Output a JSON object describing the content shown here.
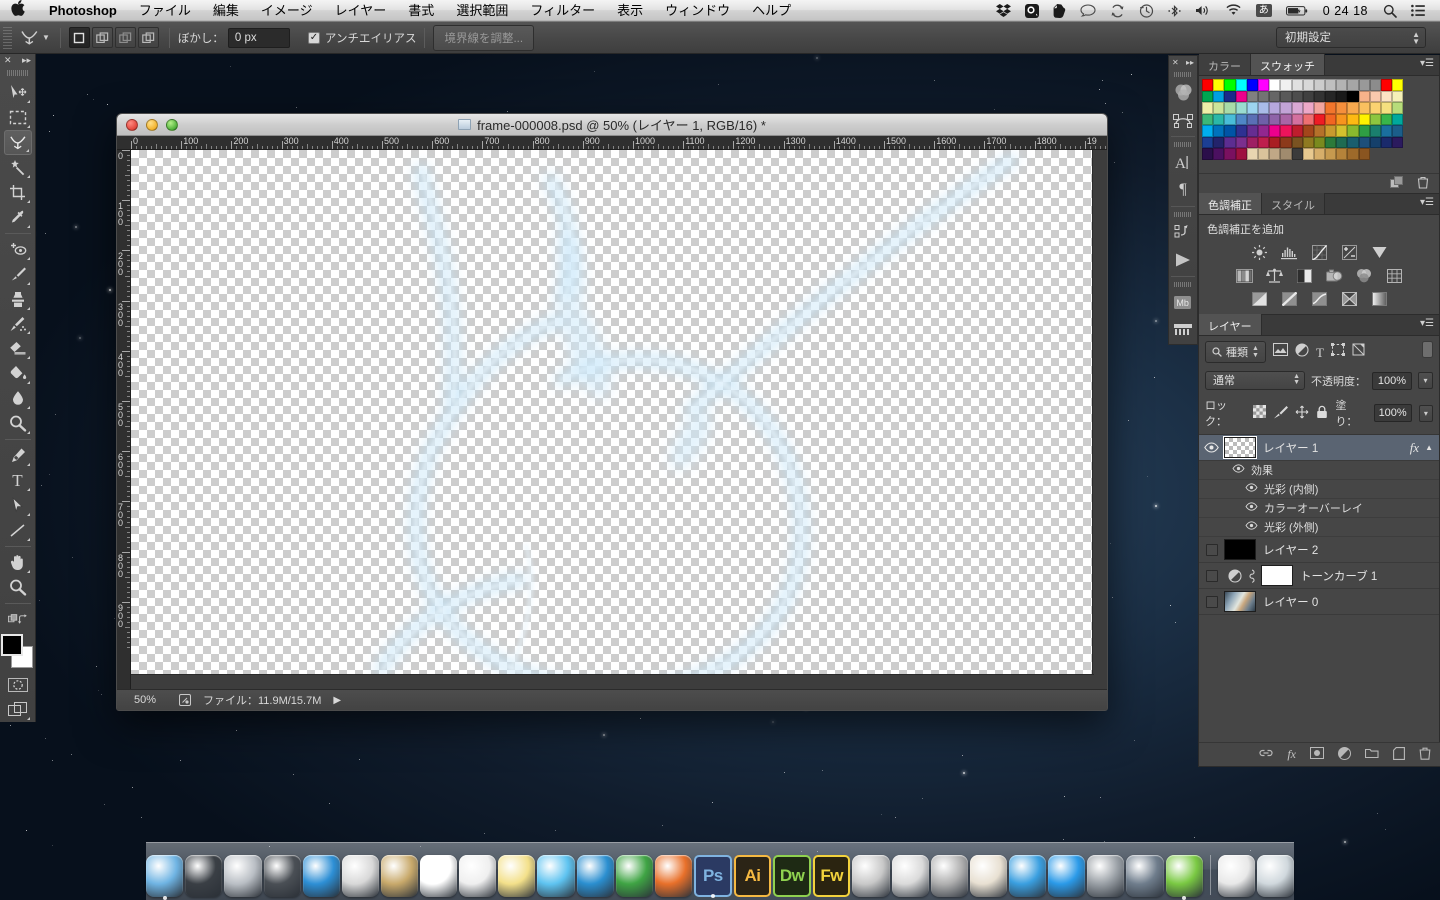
{
  "menubar": {
    "apple_icon": "apple-icon",
    "app_name": "Photoshop",
    "menus": [
      "ファイル",
      "編集",
      "イメージ",
      "レイヤー",
      "書式",
      "選択範囲",
      "フィルター",
      "表示",
      "ウィンドウ",
      "ヘルプ"
    ],
    "status_icons": [
      "dropbox-icon",
      "quicktime-icon",
      "evernote-icon",
      "chat-bubble-icon",
      "sync-icon",
      "time-machine-icon",
      "bluetooth-icon",
      "volume-icon",
      "wifi-icon"
    ],
    "ime_label": "あ",
    "battery_icon": "battery-icon",
    "clock": "0 24 18",
    "spotlight_icon": "search-icon",
    "notification_icon": "list-icon"
  },
  "options_bar": {
    "tool_icon": "lasso-tool-icon",
    "tool_dropdown": "chevron-down-icon",
    "selection_modes": [
      "new-selection",
      "add-to-selection",
      "subtract-from-selection",
      "intersect-selection"
    ],
    "feather_label": "ぼかし：",
    "feather_value": "0 px",
    "antialias_label": "アンチエイリアス",
    "antialias_checked": true,
    "refine_edge_label": "境界線を調整...",
    "workspace_value": "初期設定"
  },
  "toolbar": {
    "collapse_icon": "collapse-icon",
    "expand_icon": "expand-icon",
    "tools": [
      {
        "name": "move-tool",
        "glyph": "move"
      },
      {
        "name": "marquee-tool",
        "glyph": "marquee"
      },
      {
        "name": "lasso-tool",
        "glyph": "lasso",
        "selected": true
      },
      {
        "name": "magic-wand-tool",
        "glyph": "wand"
      },
      {
        "name": "crop-tool",
        "glyph": "crop"
      },
      {
        "name": "eyedropper-tool",
        "glyph": "eyedropper"
      },
      {
        "name": "healing-brush-tool",
        "glyph": "heal"
      },
      {
        "name": "brush-tool",
        "glyph": "brush"
      },
      {
        "name": "clone-stamp-tool",
        "glyph": "stamp"
      },
      {
        "name": "history-brush-tool",
        "glyph": "history-brush"
      },
      {
        "name": "eraser-tool",
        "glyph": "eraser"
      },
      {
        "name": "gradient-tool",
        "glyph": "bucket"
      },
      {
        "name": "blur-tool",
        "glyph": "drop"
      },
      {
        "name": "dodge-tool",
        "glyph": "dodge"
      },
      {
        "name": "pen-tool",
        "glyph": "pen"
      },
      {
        "name": "type-tool",
        "glyph": "T"
      },
      {
        "name": "path-selection-tool",
        "glyph": "arrow"
      },
      {
        "name": "line-tool",
        "glyph": "line"
      },
      {
        "name": "hand-tool",
        "glyph": "hand"
      },
      {
        "name": "zoom-tool",
        "glyph": "zoom"
      }
    ],
    "foreground_color": "#000000",
    "background_color": "#ffffff",
    "quickmask_icon": "quick-mask-icon",
    "screenmode_icon": "screen-mode-icon"
  },
  "document": {
    "title": "frame-000008.psd @ 50% (レイヤー 1, RGB/16) *",
    "traffic_lights": [
      "close-button",
      "minimize-button",
      "zoom-button"
    ],
    "ruler_h_labels": [
      "0",
      "100",
      "200",
      "300",
      "400",
      "500",
      "600",
      "700",
      "800",
      "900",
      "1000",
      "1100",
      "1200",
      "1300",
      "1400",
      "1500",
      "1600",
      "1700",
      "1800",
      "19"
    ],
    "ruler_v_labels": [
      "0",
      "100",
      "200",
      "300",
      "400",
      "500",
      "600",
      "700",
      "800",
      "900"
    ],
    "status_zoom": "50%",
    "status_text": "ファイル：11.9M/15.7M",
    "status_arrow": "play-arrow-icon"
  },
  "icon_dock": {
    "items": [
      {
        "name": "color-panel-icon",
        "glyph": "color"
      },
      {
        "name": "paths-panel-icon",
        "glyph": "paths"
      },
      {
        "name": "character-panel-icon",
        "glyph": "A"
      },
      {
        "name": "paragraph-panel-icon",
        "glyph": "¶"
      },
      {
        "name": "actions-panel-icon",
        "glyph": "actions"
      },
      {
        "name": "timeline-play-icon",
        "glyph": "play"
      },
      {
        "name": "measurement-log-icon",
        "glyph": "Mb"
      },
      {
        "name": "timeline-panel-icon",
        "glyph": "film"
      }
    ]
  },
  "color_panel": {
    "tabs": [
      {
        "label": "カラー",
        "active": false
      },
      {
        "label": "スウォッチ",
        "active": true
      }
    ],
    "menu_icon": "panel-menu-icon",
    "new_swatch_icon": "new-swatch-icon",
    "delete_icon": "trash-icon",
    "swatch_colors": [
      "#ff0000",
      "#ffff00",
      "#00ff00",
      "#00ffff",
      "#0000ff",
      "#ff00ff",
      "#ffffff",
      "#f0f0f0",
      "#e0e0e0",
      "#d8d8d8",
      "#cccccc",
      "#bfbfbf",
      "#b3b3b3",
      "#a6a6a6",
      "#999999",
      "#8c8c8c",
      "#ff0000",
      "#ffff00",
      "#00a651",
      "#00a0e0",
      "#1b2a8a",
      "#ec008c",
      "#808080",
      "#737373",
      "#666666",
      "#595959",
      "#4d4d4d",
      "#404040",
      "#333333",
      "#262626",
      "#1a1a1a",
      "#000000",
      "#f7b38a",
      "#f9c9ad",
      "#fde4c4",
      "#f5f0b8",
      "#eeefa8",
      "#cbe49a",
      "#a8dba8",
      "#9adcd0",
      "#9cd4ef",
      "#a9bce8",
      "#b6a8dd",
      "#c2a3d6",
      "#d9a8d4",
      "#eda8c8",
      "#f2a59e",
      "#f2762c",
      "#f58f3c",
      "#f8a94e",
      "#fac05f",
      "#fbd271",
      "#f5e07f",
      "#b7dc7a",
      "#3cb878",
      "#2bb8a8",
      "#49bdd8",
      "#4f86c6",
      "#5a6fb5",
      "#6f5fa8",
      "#8e63a8",
      "#a965a5",
      "#d4709f",
      "#ef6f72",
      "#ee1c24",
      "#f26522",
      "#f7941e",
      "#fdb913",
      "#fff200",
      "#8dc63f",
      "#39b54a",
      "#00a99d",
      "#00aeef",
      "#0072bc",
      "#0054a6",
      "#2e3192",
      "#662d91",
      "#92278f",
      "#ec008c",
      "#ed145b",
      "#be1e2d",
      "#a3461b",
      "#b5712a",
      "#c99a2e",
      "#d4c12e",
      "#8ab92e",
      "#2f9e44",
      "#1a7f6e",
      "#1a6f9e",
      "#1b5e8a",
      "#1c3f94",
      "#23236b",
      "#5c2d91",
      "#7b2f8e",
      "#9e1f63",
      "#be1e4d",
      "#a91e22",
      "#8c3a1b",
      "#7a5321",
      "#8f7a21",
      "#7a8a1e",
      "#2b7a3a",
      "#1f6b52",
      "#1a5e6e",
      "#1d4f7a",
      "#15406b",
      "#1a2a6b",
      "#2b1a5e",
      "#2b0f4a",
      "#4b1060",
      "#7a1060",
      "#9e1040",
      "#e8d5b0",
      "#d9c39b",
      "#c0a886",
      "#a08b6e",
      "#3b3b3b",
      "#e8c98f",
      "#d6ae6a",
      "#c69a4f",
      "#b5833a",
      "#9e6a2a",
      "#8a5520",
      "",
      "",
      "",
      ""
    ]
  },
  "adjustments_panel": {
    "tabs": [
      {
        "label": "色調補正",
        "active": true
      },
      {
        "label": "スタイル",
        "active": false
      }
    ],
    "menu_icon": "panel-menu-icon",
    "heading": "色調補正を追加",
    "rows": [
      [
        "brightness-contrast-icon",
        "levels-icon",
        "curves-icon",
        "exposure-icon",
        "vibrance-icon"
      ],
      [
        "hue-saturation-icon",
        "color-balance-icon",
        "black-white-icon",
        "photo-filter-icon",
        "channel-mixer-icon",
        "color-lookup-icon"
      ],
      [
        "invert-icon",
        "posterize-icon",
        "threshold-icon",
        "selective-color-icon",
        "gradient-map-icon"
      ]
    ]
  },
  "layers_panel": {
    "tab_label": "レイヤー",
    "menu_icon": "panel-menu-icon",
    "filter_label": "種類",
    "filter_icon": "search-icon",
    "filter_toggles": [
      "pixel-filter-icon",
      "adjustment-filter-icon",
      "type-filter-icon",
      "shape-filter-icon",
      "smartobject-filter-icon"
    ],
    "filter_power_icon": "filter-power-icon",
    "blend_mode": "通常",
    "opacity_label": "不透明度：",
    "opacity_value": "100%",
    "lock_label": "ロック：",
    "lock_icons": [
      "lock-transparency-icon",
      "lock-image-icon",
      "lock-position-icon",
      "lock-all-icon"
    ],
    "fill_label": "塗り：",
    "fill_value": "100%",
    "layers": [
      {
        "name": "レイヤー 1",
        "visible": true,
        "selected": true,
        "thumb": "transparent",
        "fx_badge": "fx",
        "expand_icon": "chevron-up-icon",
        "effects_label": "効果",
        "effects": [
          "光彩 (内側)",
          "カラーオーバーレイ",
          "光彩 (外側)"
        ]
      },
      {
        "name": "レイヤー 2",
        "visible": false,
        "selected": false,
        "thumb": "#000000"
      },
      {
        "name": "トーンカーブ 1",
        "visible": false,
        "selected": false,
        "thumb": "#ffffff",
        "adjustment_icon": "curves-icon",
        "link_icon": "link-icon"
      },
      {
        "name": "レイヤー 0",
        "visible": false,
        "selected": false,
        "thumb": "image"
      }
    ],
    "footer_icons": [
      "link-layers-icon",
      "layer-style-icon",
      "layer-mask-icon",
      "new-adjustment-icon",
      "new-group-icon",
      "new-layer-icon",
      "delete-layer-icon"
    ]
  },
  "dock": {
    "items": [
      {
        "name": "finder",
        "label": "finder-icon",
        "color": "#6fb4e3",
        "running": true
      },
      {
        "name": "dashboard",
        "label": "dashboard-icon",
        "color": "#3a3f45",
        "running": false
      },
      {
        "name": "launchpad",
        "label": "launchpad-icon",
        "color": "#b9bec4",
        "running": false
      },
      {
        "name": "mission-control",
        "label": "mission-control-icon",
        "color": "#4a4f55",
        "running": false
      },
      {
        "name": "safari",
        "label": "safari-icon",
        "color": "#2d8fd5",
        "running": false
      },
      {
        "name": "mail",
        "label": "mail-icon",
        "color": "#d8d8d8",
        "running": false
      },
      {
        "name": "contacts",
        "label": "contacts-icon",
        "color": "#c8a96b",
        "running": false
      },
      {
        "name": "calendar",
        "label": "calendar-icon",
        "color": "#ffffff",
        "running": false
      },
      {
        "name": "reminders",
        "label": "reminders-icon",
        "color": "#efefef",
        "running": false
      },
      {
        "name": "notes",
        "label": "notes-icon",
        "color": "#f3e08a",
        "running": false
      },
      {
        "name": "messages",
        "label": "messages-icon",
        "color": "#5ec3f0",
        "running": false
      },
      {
        "name": "word",
        "label": "word-icon",
        "color": "#2b8fd0",
        "running": false
      },
      {
        "name": "excel",
        "label": "excel-icon",
        "color": "#3fa444",
        "running": false
      },
      {
        "name": "powerpoint",
        "label": "powerpoint-icon",
        "color": "#e8702a",
        "running": false
      },
      {
        "name": "photoshop",
        "label": "Ps",
        "color": "#2b3a63",
        "running": true,
        "adobe": true,
        "text_color": "#7fb3e0"
      },
      {
        "name": "illustrator",
        "label": "Ai",
        "color": "#2b2416",
        "running": false,
        "adobe": true,
        "text_color": "#f5b942"
      },
      {
        "name": "dreamweaver",
        "label": "Dw",
        "color": "#1e2a14",
        "running": false,
        "adobe": true,
        "text_color": "#8fd14f"
      },
      {
        "name": "fireworks",
        "label": "Fw",
        "color": "#2b2410",
        "running": false,
        "adobe": true,
        "text_color": "#f2d23c"
      },
      {
        "name": "final-cut",
        "label": "final-cut-icon",
        "color": "#c8c8c8",
        "running": false
      },
      {
        "name": "motion",
        "label": "motion-icon",
        "color": "#dadada",
        "running": false
      },
      {
        "name": "compressor",
        "label": "compressor-icon",
        "color": "#b0b0b0",
        "running": false
      },
      {
        "name": "iphoto",
        "label": "iphoto-icon",
        "color": "#e8e0d2",
        "running": false
      },
      {
        "name": "itunes",
        "label": "itunes-icon",
        "color": "#3a9fe0",
        "running": false
      },
      {
        "name": "app-store",
        "label": "app-store-icon",
        "color": "#2b9ae8",
        "running": false
      },
      {
        "name": "system-preferences",
        "label": "system-preferences-icon",
        "color": "#9aa0a6",
        "running": false
      },
      {
        "name": "time-machine",
        "label": "time-machine-icon",
        "color": "#6f7d8c",
        "running": false
      },
      {
        "name": "evernote",
        "label": "evernote-icon",
        "color": "#7ac943",
        "running": true
      }
    ],
    "trash_items": [
      {
        "name": "downloads-stack",
        "label": "apple-logo-icon",
        "color": "#e8e8e8"
      },
      {
        "name": "trash",
        "label": "trash-icon",
        "color": "#d0d8dd"
      }
    ]
  }
}
